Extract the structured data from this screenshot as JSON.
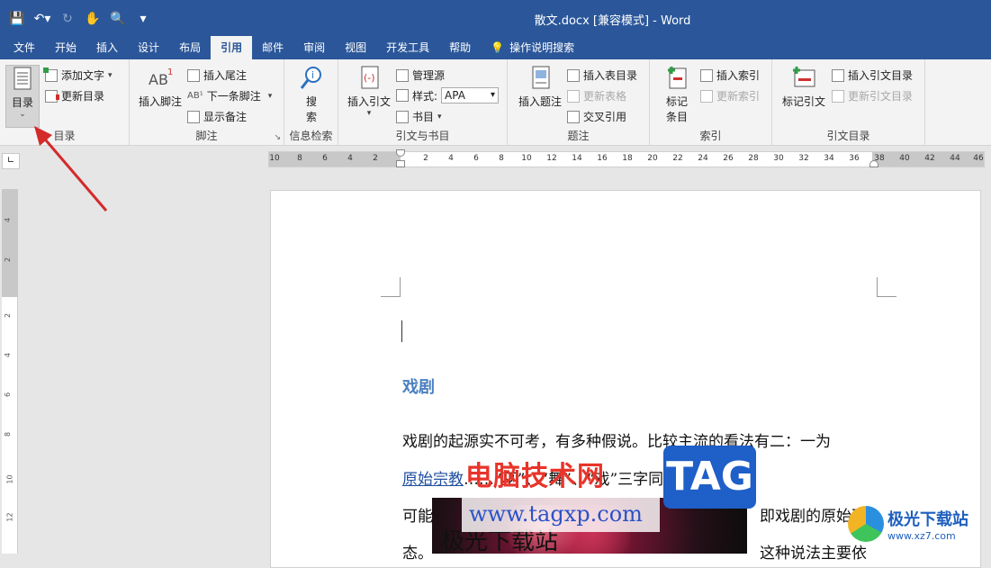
{
  "window": {
    "title": "散文.docx [兼容模式]  -  Word"
  },
  "qat": {
    "save": "save-icon",
    "undo": "undo-icon",
    "redo": "redo-icon",
    "touch": "touch-mode-icon",
    "preview": "print-preview-icon",
    "more": "customize-icon"
  },
  "tabs": [
    "文件",
    "开始",
    "插入",
    "设计",
    "布局",
    "引用",
    "邮件",
    "审阅",
    "视图",
    "开发工具",
    "帮助",
    "操作说明搜索"
  ],
  "active_tab": "引用",
  "ribbon": {
    "toc": {
      "label": "目录",
      "big": "目录",
      "add_text": "添加文字",
      "update_toc": "更新目录"
    },
    "footnotes": {
      "label": "脚注",
      "insert_footnote": "插入脚注",
      "insert_endnote": "插入尾注",
      "next_footnote": "下一条脚注",
      "show_notes": "显示备注"
    },
    "research": {
      "label": "信息检索",
      "search": "搜\n索",
      "search_l1": "搜",
      "search_l2": "索"
    },
    "citations": {
      "label": "引文与书目",
      "insert_citation": "插入引文",
      "manage_sources": "管理源",
      "style_label": "样式:",
      "style_value": "APA",
      "bibliography": "书目"
    },
    "captions": {
      "label": "题注",
      "insert_caption": "插入题注",
      "insert_table_of_figures": "插入表目录",
      "update_table": "更新表格",
      "cross_reference": "交叉引用"
    },
    "index": {
      "label": "索引",
      "mark_entry_l1": "标记",
      "mark_entry_l2": "条目",
      "insert_index": "插入索引",
      "update_index": "更新索引"
    },
    "toa": {
      "label": "引文目录",
      "mark_citation": "标记引文",
      "insert_toa": "插入引文目录",
      "update_toa": "更新引文目录"
    }
  },
  "hruler": {
    "left_numbers": [
      "10",
      "8",
      "6",
      "4",
      "2"
    ],
    "numbers": [
      "2",
      "4",
      "6",
      "8",
      "10",
      "12",
      "14",
      "16",
      "18",
      "20",
      "22",
      "24",
      "26",
      "28",
      "30",
      "32",
      "34",
      "36",
      "38",
      "40",
      "42",
      "44",
      "46"
    ]
  },
  "vruler": {
    "numbers": [
      "4",
      "2",
      "2",
      "4",
      "6",
      "8",
      "10",
      "12"
    ]
  },
  "document": {
    "heading": "戏剧",
    "line1": "戏剧的起源实不可考，有多种假说。比较主流的看法有二：一为",
    "line2_link": "原始宗教",
    "line2_rest": "……“巫”、“舞”、“戏”三字同源，",
    "line3_start": "可能",
    "line3_end": "即戏剧的原始形",
    "line4_start": "态。",
    "line4_end": "这种说法主要依",
    "image_text": "极光下载站"
  },
  "watermarks": {
    "cn": "电脑技术网",
    "url": "www.tagxp.com",
    "tag": "TAG",
    "jg_title": "极光下载站",
    "jg_url": "www.xz7.com"
  }
}
